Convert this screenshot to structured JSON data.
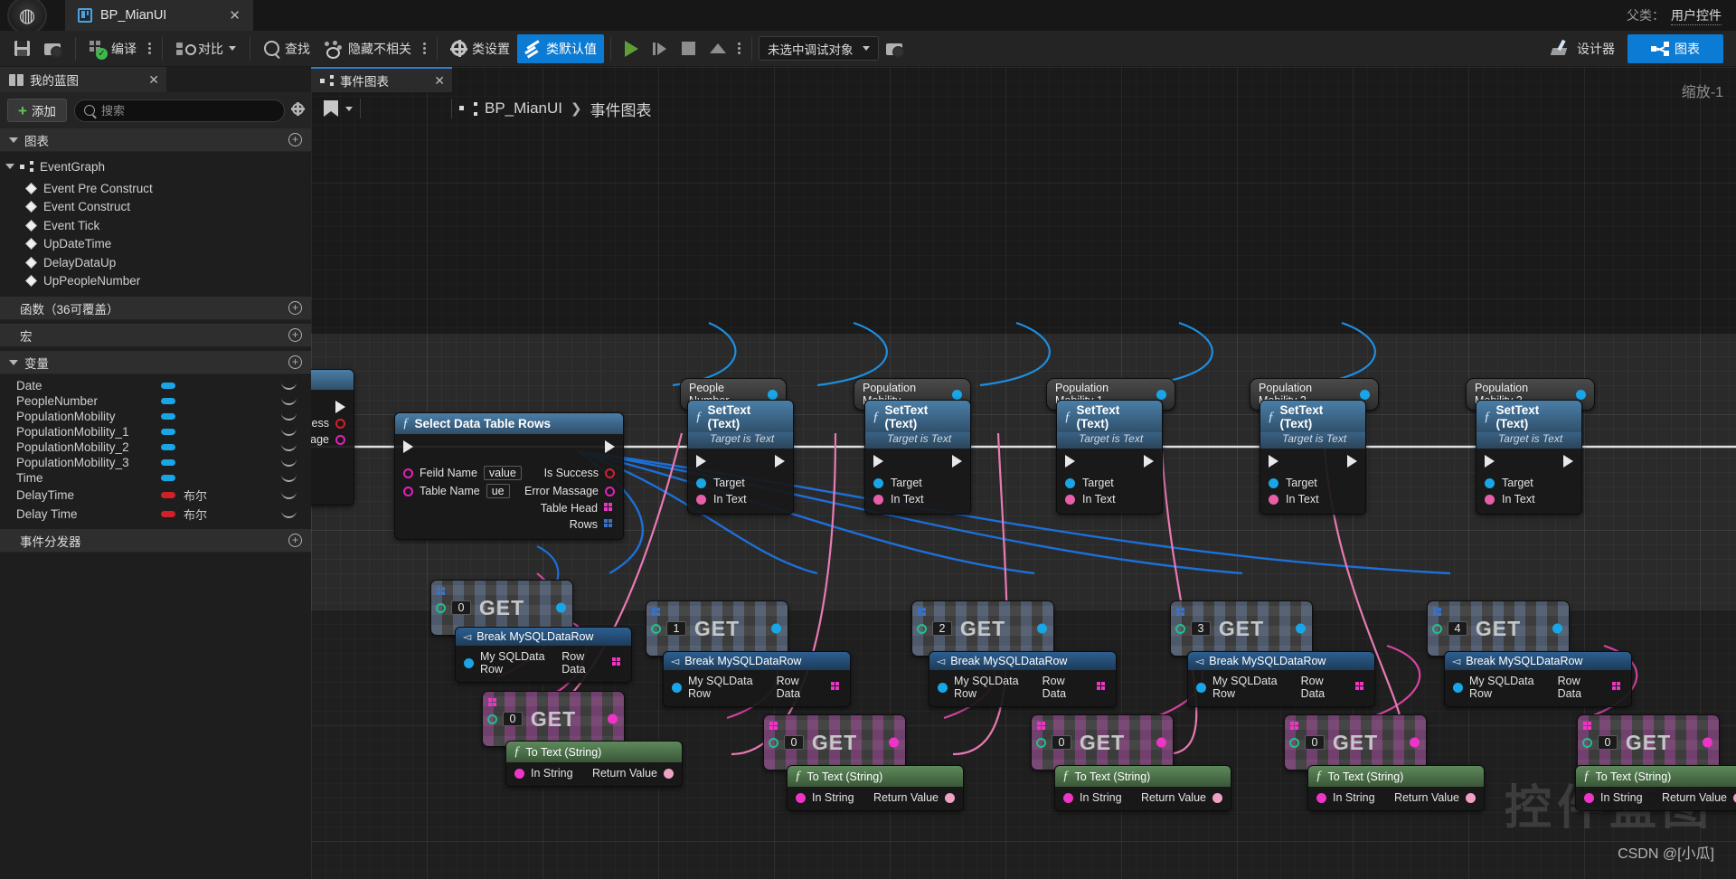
{
  "titlebar": {
    "asset_tab": "BP_MianUI",
    "close_icon": "close-icon",
    "parent_label": "父类：",
    "parent_value": "用户控件"
  },
  "toolbar": {
    "save": "",
    "browse": "",
    "compile": "编译",
    "diff": "对比",
    "find": "查找",
    "hide_unrelated": "隐藏不相关",
    "class_settings": "类设置",
    "class_defaults": "类默认值",
    "debug_target": "未选中调试对象",
    "designer": "设计器",
    "graph": "图表"
  },
  "my_blueprint": {
    "tab_title": "我的蓝图",
    "add_button": "添加",
    "search_placeholder": "搜索",
    "sections": {
      "graphs": "图表",
      "functions": "函数（36可覆盖）",
      "macros": "宏",
      "variables": "变量",
      "event_dispatchers": "事件分发器"
    },
    "event_graph": "EventGraph",
    "events": [
      "Event Pre Construct",
      "Event Construct",
      "Event Tick",
      "UpDateTime",
      "DelayDataUp",
      "UpPeopleNumber"
    ],
    "variables": [
      {
        "name": "Date",
        "type": "",
        "color": "#19a5e6"
      },
      {
        "name": "PeopleNumber",
        "type": "",
        "color": "#19a5e6"
      },
      {
        "name": "PopulationMobility",
        "type": "",
        "color": "#19a5e6"
      },
      {
        "name": "PopulationMobility_1",
        "type": "",
        "color": "#19a5e6"
      },
      {
        "name": "PopulationMobility_2",
        "type": "",
        "color": "#19a5e6"
      },
      {
        "name": "PopulationMobility_3",
        "type": "",
        "color": "#19a5e6"
      },
      {
        "name": "Time",
        "type": "",
        "color": "#19a5e6"
      },
      {
        "name": "DelayTime",
        "type": "布尔",
        "color": "#d0202a"
      },
      {
        "name": "Delay Time",
        "type": "布尔",
        "color": "#d0202a"
      }
    ]
  },
  "graph_panel": {
    "tab_title": "事件图表",
    "breadcrumb_root": "BP_MianUI",
    "breadcrumb_sep": "❯",
    "breadcrumb_current": "事件图表",
    "zoom_label": "缩放-1",
    "watermark": "控件蓝图",
    "watermark_credit": "CSDN @[小瓜]"
  },
  "nodes": {
    "hidden_node": {
      "out_is_success": "ccess",
      "out_error": "ssage"
    },
    "select_rows": {
      "title": "Select Data Table Rows",
      "in_field_name": "Feild Name",
      "in_field_value": "value",
      "in_table_name": "Table Name",
      "in_table_value": "ue",
      "out_is_success": "Is Success",
      "out_error": "Error Massage",
      "out_table_head": "Table Head",
      "out_rows": "Rows"
    },
    "settext": {
      "title": "SetText (Text)",
      "subtitle": "Target is Text",
      "target": "Target",
      "in_text": "In Text"
    },
    "break": {
      "title": "Break MySQLDataRow",
      "in": "My SQLData Row",
      "out": "Row Data"
    },
    "totext": {
      "title": "To Text (String)",
      "in": "In String",
      "out": "Return Value"
    },
    "get_label": "GET",
    "settext_chain": [
      {
        "bubble": "People Number",
        "row_index": "0",
        "inner_index": "0"
      },
      {
        "bubble": "Population Mobility",
        "row_index": "1",
        "inner_index": "0"
      },
      {
        "bubble": "Population Mobility 1",
        "row_index": "2",
        "inner_index": "0"
      },
      {
        "bubble": "Population Mobility 2",
        "row_index": "3",
        "inner_index": "0"
      },
      {
        "bubble": "Population Mobility 3",
        "row_index": "4",
        "inner_index": "0"
      }
    ]
  },
  "colors": {
    "accent_blue": "#0c7bd4",
    "exec_white": "#e8e8e8",
    "text_pin": "#e85fa8",
    "object_pin": "#19a5e6",
    "struct_pin": "#ef35c8",
    "bool_pin": "#d0202a",
    "int_pin": "#21c08a"
  }
}
